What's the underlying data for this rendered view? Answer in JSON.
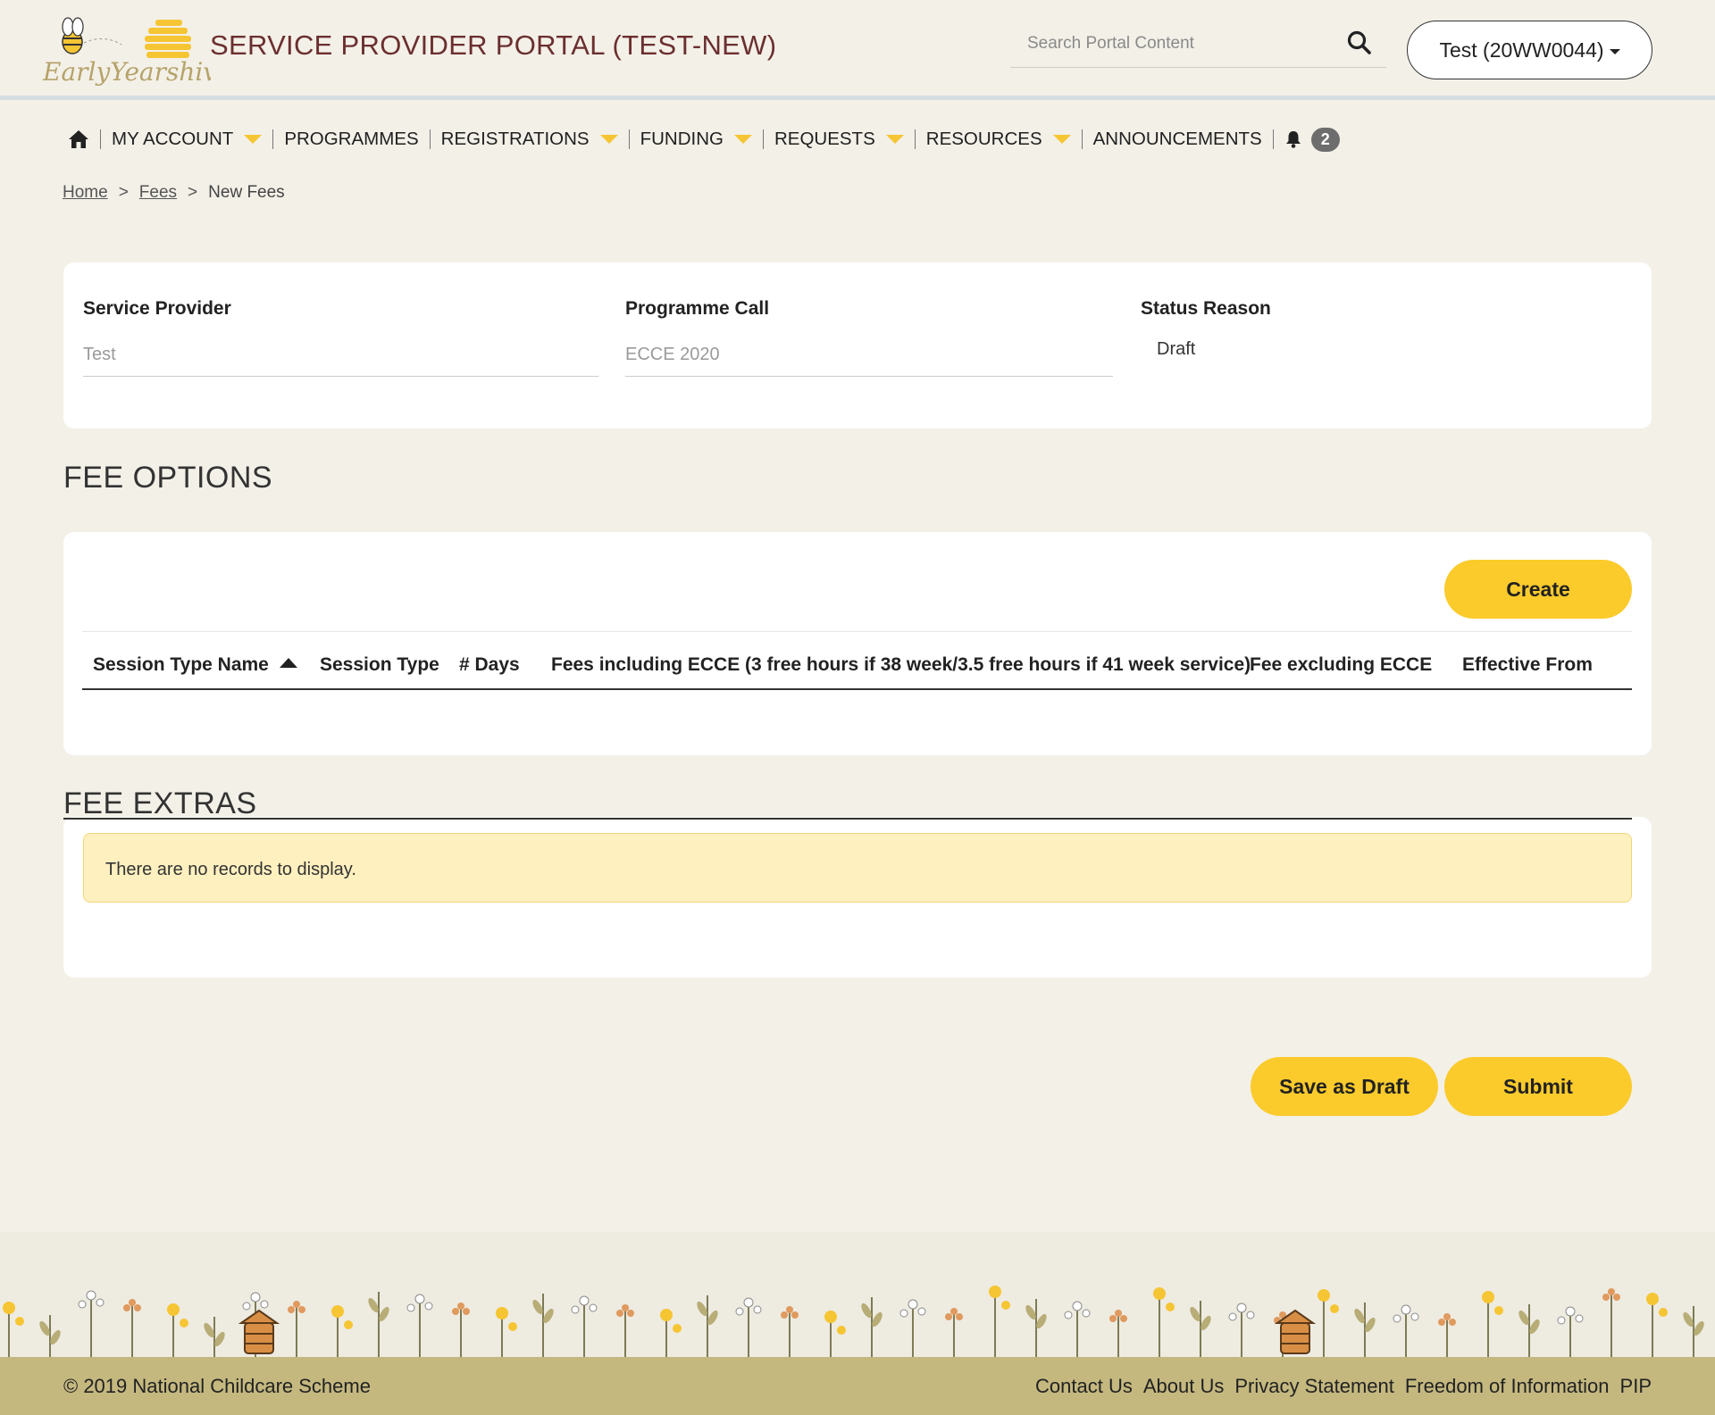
{
  "header": {
    "logo_text": "EarlyYearshive",
    "portal_title": "SERVICE PROVIDER PORTAL (TEST-NEW)",
    "search_placeholder": "Search Portal Content",
    "account_label": "Test (20WW0044)"
  },
  "nav": {
    "items": [
      {
        "label": "MY ACCOUNT",
        "has_dropdown": true
      },
      {
        "label": "PROGRAMMES",
        "has_dropdown": false
      },
      {
        "label": "REGISTRATIONS",
        "has_dropdown": true
      },
      {
        "label": "FUNDING",
        "has_dropdown": true
      },
      {
        "label": "REQUESTS",
        "has_dropdown": true
      },
      {
        "label": "RESOURCES",
        "has_dropdown": true
      },
      {
        "label": "ANNOUNCEMENTS",
        "has_dropdown": false
      }
    ],
    "notification_count": "2"
  },
  "breadcrumb": {
    "home": "Home",
    "fees": "Fees",
    "sep": ">",
    "current": "New Fees"
  },
  "details": {
    "service_provider_label": "Service Provider",
    "service_provider_value": "Test",
    "programme_call_label": "Programme Call",
    "programme_call_value": "ECCE 2020",
    "status_reason_label": "Status Reason",
    "status_reason_value": "Draft"
  },
  "fee_options": {
    "heading": "FEE OPTIONS",
    "create_label": "Create",
    "columns": [
      "Session Type Name",
      "Session Type",
      "# Days",
      "Fees including ECCE (3 free hours if 38 week/3.5 free hours if 41 week service)",
      "Fee excluding ECCE",
      "Effective From"
    ],
    "sorted_column": "Session Type Name",
    "sort_direction": "ascending"
  },
  "fee_extras": {
    "heading": "FEE EXTRAS",
    "empty_message": "There are no records to display."
  },
  "actions": {
    "save_draft_label": "Save as Draft",
    "submit_label": "Submit"
  },
  "footer": {
    "copyright": "© 2019 National Childcare Scheme",
    "links": [
      "Contact Us",
      "About Us",
      "Privacy Statement",
      "Freedom of Information",
      "PIP"
    ]
  },
  "colors": {
    "accent_yellow": "#fbcb2c",
    "title_maroon": "#6b2f2f",
    "footer_olive": "#c4b87f",
    "page_bg": "#f3f0e8"
  }
}
